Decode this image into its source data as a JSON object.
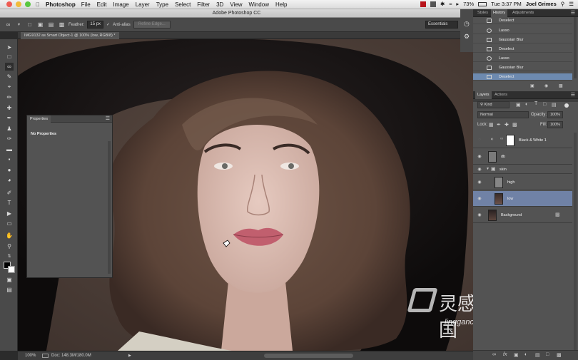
{
  "menubar": {
    "app": "Photoshop",
    "menus": [
      "File",
      "Edit",
      "Image",
      "Layer",
      "Type",
      "Select",
      "Filter",
      "3D",
      "View",
      "Window",
      "Help"
    ],
    "battery": "73%",
    "clock": "Tue 3:37 PM",
    "user": "Joel Grimes"
  },
  "window": {
    "title": "Adobe Photoshop CC"
  },
  "options": {
    "feather_label": "Feather:",
    "feather_value": "15 px",
    "antialias_label": "Anti-alias",
    "refine_label": "Refine Edge...",
    "workspace": "Essentials"
  },
  "document": {
    "tab_title": "IMG9132 as Smart Object-1 @ 100% (low, RGB/8) *"
  },
  "status": {
    "zoom": "100%",
    "doc": "Doc: 148.3M/180.0M"
  },
  "properties": {
    "tab": "Properties",
    "text": "No Properties"
  },
  "history": {
    "tabs": [
      "Styles",
      "History",
      "Adjustments"
    ],
    "items": [
      "Deselect",
      "Lasso",
      "Gaussian Blur",
      "Deselect",
      "Lasso",
      "Gaussian Blur",
      "Deselect"
    ],
    "selected_index": 6
  },
  "layers": {
    "tabs": [
      "Layers",
      "Actions"
    ],
    "filter": "Kind",
    "blend_mode": "Normal",
    "opacity_label": "Opacity:",
    "opacity": "100%",
    "lock_label": "Lock:",
    "fill_label": "Fill:",
    "fill": "100%",
    "items": [
      {
        "name": "Black & White 1"
      },
      {
        "name": "db"
      },
      {
        "name": "skin"
      },
      {
        "name": "high"
      },
      {
        "name": "low"
      },
      {
        "name": "Background"
      }
    ],
    "selected_index": 4
  },
  "watermark": {
    "name": "灵感中国",
    "url": "lingganchina.com"
  },
  "colors": {
    "accent": "#6d8ab0",
    "panel": "#535353",
    "toolbar": "#4a4a4a"
  }
}
